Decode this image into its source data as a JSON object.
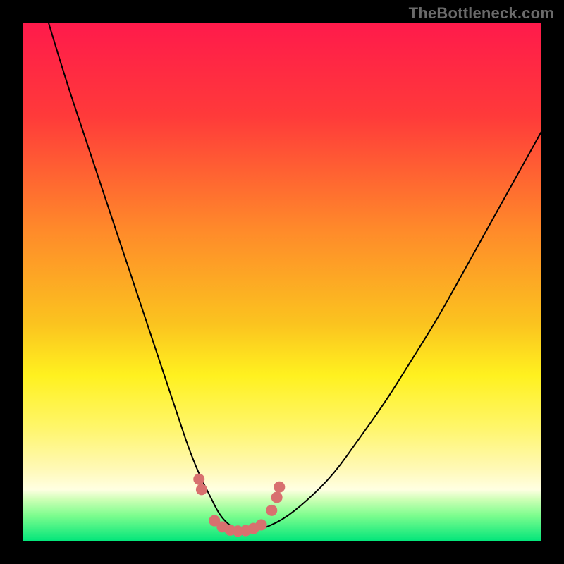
{
  "watermark": "TheBottleneck.com",
  "colors": {
    "frame": "#000000",
    "curve": "#000000",
    "dots": "#d8706f",
    "gradient_stops": [
      {
        "offset": 0.0,
        "color": "#ff1a4b"
      },
      {
        "offset": 0.18,
        "color": "#ff3a3a"
      },
      {
        "offset": 0.4,
        "color": "#ff8a2a"
      },
      {
        "offset": 0.58,
        "color": "#fbc31f"
      },
      {
        "offset": 0.68,
        "color": "#fff11f"
      },
      {
        "offset": 0.78,
        "color": "#fff66a"
      },
      {
        "offset": 0.86,
        "color": "#fff9b6"
      },
      {
        "offset": 0.9,
        "color": "#ffffe2"
      },
      {
        "offset": 0.92,
        "color": "#cbffb4"
      },
      {
        "offset": 0.95,
        "color": "#7dfd8e"
      },
      {
        "offset": 1.0,
        "color": "#00e57a"
      }
    ]
  },
  "chart_data": {
    "type": "line",
    "title": "",
    "xlabel": "",
    "ylabel": "",
    "xlim": [
      0,
      100
    ],
    "ylim": [
      0,
      100
    ],
    "grid": false,
    "series": [
      {
        "name": "bottleneck-curve",
        "x": [
          5,
          8,
          12,
          16,
          20,
          24,
          28,
          30,
          32,
          34,
          36,
          38,
          40,
          42,
          45,
          50,
          55,
          60,
          65,
          70,
          75,
          80,
          85,
          90,
          95,
          100
        ],
        "y": [
          100,
          90,
          78,
          66,
          54,
          42,
          30,
          24,
          18,
          13,
          9,
          5,
          3,
          2,
          2,
          4,
          8,
          13,
          20,
          27,
          35,
          43,
          52,
          61,
          70,
          79
        ]
      }
    ],
    "highlight_points": {
      "name": "minimum-region-dots",
      "x": [
        34,
        34.5,
        37,
        38.5,
        40,
        41.5,
        43,
        44.5,
        46,
        48,
        49,
        49.5
      ],
      "y": [
        12,
        10,
        4,
        2.8,
        2.2,
        2,
        2.1,
        2.5,
        3.2,
        6,
        8.5,
        10.5
      ]
    }
  }
}
